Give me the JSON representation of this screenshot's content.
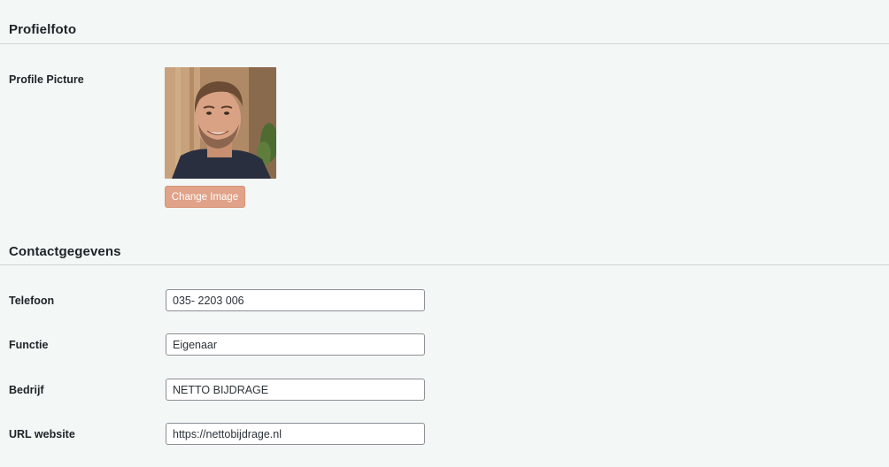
{
  "sections": {
    "profile_photo_title": "Profielfoto",
    "contact_title": "Contactgegevens"
  },
  "profile_picture": {
    "label": "Profile Picture",
    "change_button_label": "Change Image"
  },
  "contact_fields": {
    "telefoon": {
      "label": "Telefoon",
      "value": "035- 2203 006"
    },
    "functie": {
      "label": "Functie",
      "value": "Eigenaar"
    },
    "bedrijf": {
      "label": "Bedrijf",
      "value": "NETTO BIJDRAGE"
    },
    "url": {
      "label": "URL website",
      "value": "https://nettobijdrage.nl"
    }
  },
  "colors": {
    "background": "#f3f7f6",
    "button_accent": "#e0a288",
    "divider": "#cfd6d5",
    "input_border": "#8c8f94"
  }
}
